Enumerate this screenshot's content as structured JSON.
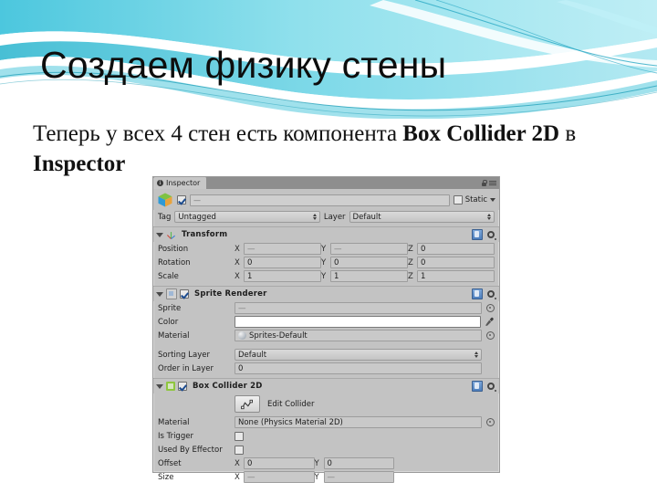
{
  "slide": {
    "title": "Создаем физику стены",
    "body_plain": "Теперь у всех 4 стен есть компонента Box Collider 2D в Inspector",
    "body_part1": "Теперь у всех 4 стен есть компонента ",
    "body_bold1": "Box Collider 2D",
    "body_part2": " в ",
    "body_bold2": "Inspector",
    "accent_color": "#4fc3d9",
    "background_color": "#ffffff"
  },
  "inspector": {
    "tab_label": "Inspector",
    "tab_icon": "info-icon",
    "lock_icon": "lock-icon",
    "menu_icon": "hamburger-menu-icon",
    "object": {
      "enabled_checkbox": true,
      "name_value": "—",
      "static_label": "Static",
      "static_checked": false,
      "tag_label": "Tag",
      "tag_value": "Untagged",
      "layer_label": "Layer",
      "layer_value": "Default"
    },
    "components": [
      {
        "name": "Transform",
        "icon": "transform-axis-icon",
        "has_enable_checkbox": false,
        "expanded": true,
        "rows": [
          {
            "label": "Position",
            "type": "vector3",
            "axes": [
              "X",
              "Y",
              "Z"
            ],
            "values": [
              "—",
              "—",
              "0"
            ],
            "dim": [
              true,
              true,
              false
            ]
          },
          {
            "label": "Rotation",
            "type": "vector3",
            "axes": [
              "X",
              "Y",
              "Z"
            ],
            "values": [
              "0",
              "0",
              "0"
            ],
            "dim": [
              false,
              false,
              false
            ]
          },
          {
            "label": "Scale",
            "type": "vector3",
            "axes": [
              "X",
              "Y",
              "Z"
            ],
            "values": [
              "1",
              "1",
              "1"
            ],
            "dim": [
              false,
              false,
              false
            ]
          }
        ]
      },
      {
        "name": "Sprite Renderer",
        "icon": "sprite-renderer-icon",
        "has_enable_checkbox": true,
        "enabled": true,
        "expanded": true,
        "rows": [
          {
            "label": "Sprite",
            "type": "object-field",
            "value": "—",
            "dim": true,
            "picker": "target-icon"
          },
          {
            "label": "Color",
            "type": "color-field",
            "value": "",
            "swatch": "#ffffff",
            "picker": "eyedropper-icon"
          },
          {
            "label": "Material",
            "type": "object-field",
            "value": "Sprites-Default",
            "dim": false,
            "icon": "material-ball-icon",
            "picker": "target-icon"
          },
          {
            "label": "Sorting Layer",
            "type": "popup",
            "value": "Default"
          },
          {
            "label": "Order in Layer",
            "type": "text-field",
            "value": "0"
          }
        ]
      },
      {
        "name": "Box Collider 2D",
        "icon": "box-collider-2d-icon",
        "has_enable_checkbox": true,
        "enabled": true,
        "expanded": true,
        "edit_collider_label": "Edit Collider",
        "rows": [
          {
            "label": "Material",
            "type": "object-field",
            "value": "None (Physics Material 2D)",
            "dim": false,
            "picker": "target-icon"
          },
          {
            "label": "Is Trigger",
            "type": "checkbox",
            "checked": false
          },
          {
            "label": "Used By Effector",
            "type": "checkbox",
            "checked": false
          },
          {
            "label": "Offset",
            "type": "vector2",
            "axes": [
              "X",
              "Y"
            ],
            "values": [
              "0",
              "0"
            ],
            "dim": [
              false,
              false
            ]
          },
          {
            "label": "Size",
            "type": "vector2",
            "axes": [
              "X",
              "Y"
            ],
            "values": [
              "—",
              "—"
            ],
            "dim": [
              true,
              true
            ]
          }
        ]
      }
    ]
  }
}
